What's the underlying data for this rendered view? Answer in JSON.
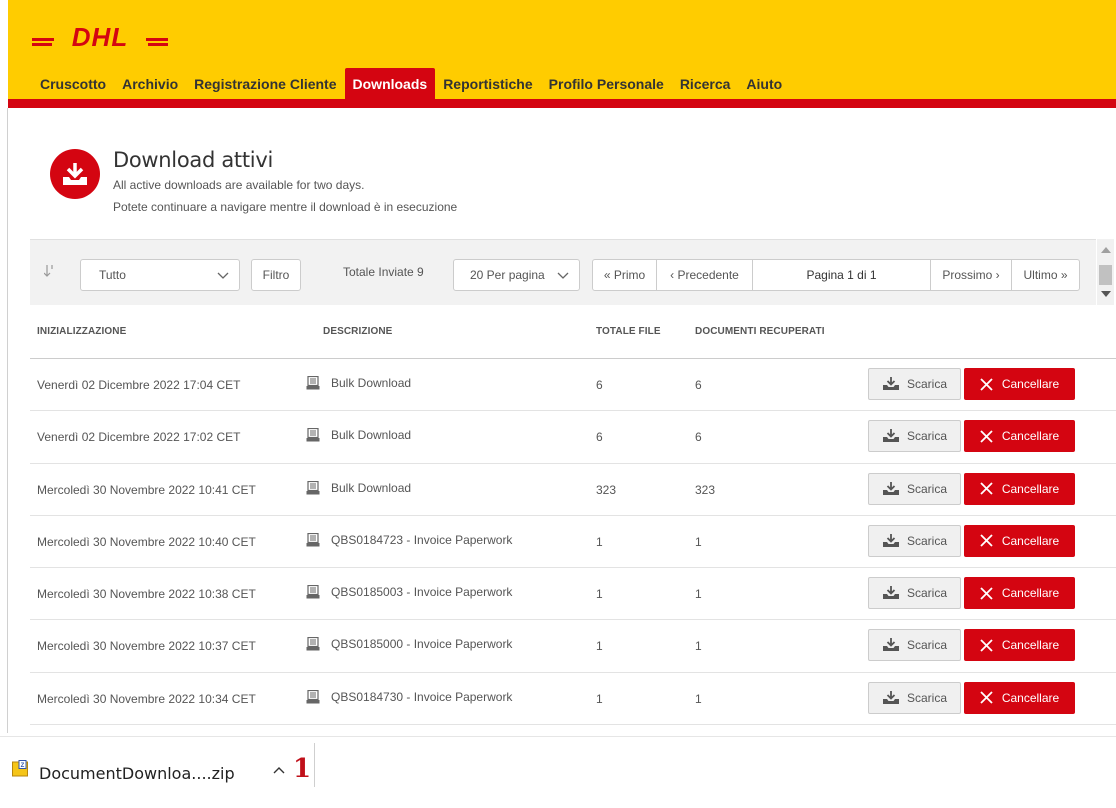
{
  "brand": {
    "logo_text": "DHL",
    "accent": "#d40511",
    "yellow": "#ffcc00"
  },
  "nav": {
    "items": [
      {
        "label": "Cruscotto"
      },
      {
        "label": "Archivio"
      },
      {
        "label": "Registrazione Cliente"
      },
      {
        "label": "Downloads",
        "active": true
      },
      {
        "label": "Reportistiche"
      },
      {
        "label": "Profilo Personale"
      },
      {
        "label": "Ricerca"
      },
      {
        "label": "Aiuto"
      }
    ]
  },
  "page": {
    "title": "Download attivi",
    "subtitle1": "All active downloads are available for two days.",
    "subtitle2": "Potete continuare a navigare mentre il download è in esecuzione",
    "icon": "download-icon"
  },
  "toolbar": {
    "filter_select_value": "Tutto",
    "filter_button": "Filtro",
    "total_label": "Totale Inviate 9",
    "per_page_value": "20 Per pagina",
    "pager": {
      "first": "« Primo",
      "prev": "‹ Precedente",
      "page": "Pagina 1 di 1",
      "next": "Prossimo ›",
      "last": "Ultimo »"
    }
  },
  "table": {
    "headers": {
      "init": "INIZIALIZZAZIONE",
      "desc": "DESCRIZIONE",
      "total": "TOTALE FILE",
      "docs": "DOCUMENTI RECUPERATI"
    },
    "download_label": "Scarica",
    "cancel_label": "Cancellare",
    "rows": [
      {
        "date": "Venerdì 02 Dicembre 2022 17:04 CET",
        "desc": "Bulk Download",
        "total": "6",
        "docs": "6"
      },
      {
        "date": "Venerdì 02 Dicembre 2022 17:02 CET",
        "desc": "Bulk Download",
        "total": "6",
        "docs": "6"
      },
      {
        "date": "Mercoledì 30 Novembre 2022 10:41 CET",
        "desc": "Bulk Download",
        "total": "323",
        "docs": "323"
      },
      {
        "date": "Mercoledì 30 Novembre 2022 10:40 CET",
        "desc": "QBS0184723 - Invoice Paperwork",
        "total": "1",
        "docs": "1"
      },
      {
        "date": "Mercoledì 30 Novembre 2022 10:38 CET",
        "desc": "QBS0185003 - Invoice Paperwork",
        "total": "1",
        "docs": "1"
      },
      {
        "date": "Mercoledì 30 Novembre 2022 10:37 CET",
        "desc": "QBS0185000 - Invoice Paperwork",
        "total": "1",
        "docs": "1"
      },
      {
        "date": "Mercoledì 30 Novembre 2022 10:34 CET",
        "desc": "QBS0184730 - Invoice Paperwork",
        "total": "1",
        "docs": "1"
      }
    ]
  },
  "download_bar": {
    "file_name": "DocumentDownloa....zip",
    "badge": "1"
  }
}
